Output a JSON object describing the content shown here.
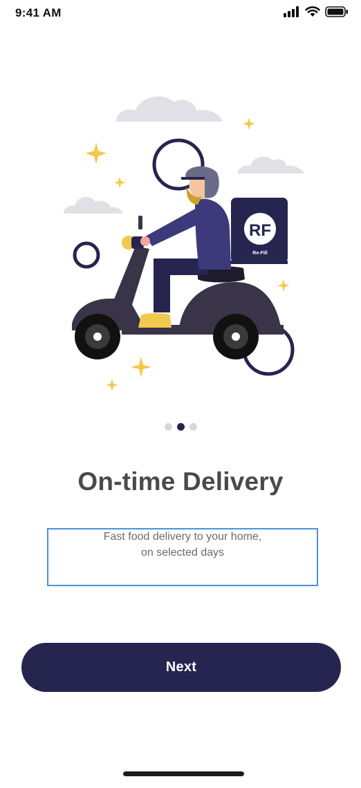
{
  "status_bar": {
    "time": "9:41 AM",
    "icons": [
      "signal-icon",
      "wifi-icon",
      "battery-icon"
    ]
  },
  "illustration": {
    "name": "scooter-delivery-illustration",
    "box_logo_text": "Re-Fill"
  },
  "pager": {
    "count": 3,
    "active_index": 1
  },
  "onboarding": {
    "title": "On-time Delivery",
    "description_line1": "Fast food delivery to your home,",
    "description_line2": "on selected days"
  },
  "actions": {
    "next_label": "Next"
  },
  "colors": {
    "primary": "#262550",
    "title_text": "#4a4a4a",
    "body_text": "#6a6a6a",
    "star": "#f2c94c",
    "focus_border": "#4a90e2"
  }
}
